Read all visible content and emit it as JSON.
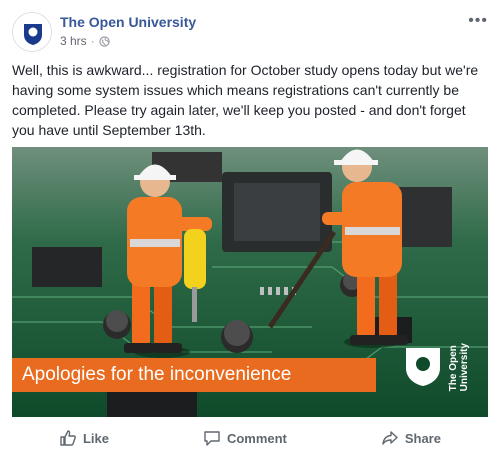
{
  "post": {
    "page_name": "The Open University",
    "time": "3 hrs",
    "separator": "·",
    "privacy_icon": "globe-icon",
    "more_icon": "ellipsis-icon",
    "text": "Well, this is awkward... registration for October study opens today but we're having some system issues which means registrations can't currently be completed. Please try again later, we'll keep you posted - and don't forget you have until September 13th."
  },
  "image": {
    "banner_text": "Apologies for the inconvenience",
    "logo_text_line1": "The Open",
    "logo_text_line2": "University"
  },
  "actions": {
    "like": "Like",
    "comment": "Comment",
    "share": "Share"
  },
  "colors": {
    "link": "#385898",
    "banner": "#e86b1f",
    "logo_blue": "#1b3a8c"
  }
}
